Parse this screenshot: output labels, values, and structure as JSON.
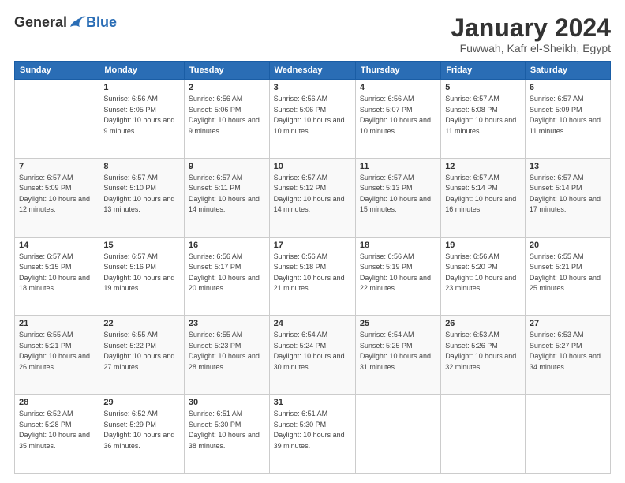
{
  "logo": {
    "general": "General",
    "blue": "Blue"
  },
  "title": "January 2024",
  "location": "Fuwwah, Kafr el-Sheikh, Egypt",
  "headers": [
    "Sunday",
    "Monday",
    "Tuesday",
    "Wednesday",
    "Thursday",
    "Friday",
    "Saturday"
  ],
  "weeks": [
    [
      {
        "day": "",
        "sunrise": "",
        "sunset": "",
        "daylight": ""
      },
      {
        "day": "1",
        "sunrise": "Sunrise: 6:56 AM",
        "sunset": "Sunset: 5:05 PM",
        "daylight": "Daylight: 10 hours and 9 minutes."
      },
      {
        "day": "2",
        "sunrise": "Sunrise: 6:56 AM",
        "sunset": "Sunset: 5:06 PM",
        "daylight": "Daylight: 10 hours and 9 minutes."
      },
      {
        "day": "3",
        "sunrise": "Sunrise: 6:56 AM",
        "sunset": "Sunset: 5:06 PM",
        "daylight": "Daylight: 10 hours and 10 minutes."
      },
      {
        "day": "4",
        "sunrise": "Sunrise: 6:56 AM",
        "sunset": "Sunset: 5:07 PM",
        "daylight": "Daylight: 10 hours and 10 minutes."
      },
      {
        "day": "5",
        "sunrise": "Sunrise: 6:57 AM",
        "sunset": "Sunset: 5:08 PM",
        "daylight": "Daylight: 10 hours and 11 minutes."
      },
      {
        "day": "6",
        "sunrise": "Sunrise: 6:57 AM",
        "sunset": "Sunset: 5:09 PM",
        "daylight": "Daylight: 10 hours and 11 minutes."
      }
    ],
    [
      {
        "day": "7",
        "sunrise": "Sunrise: 6:57 AM",
        "sunset": "Sunset: 5:09 PM",
        "daylight": "Daylight: 10 hours and 12 minutes."
      },
      {
        "day": "8",
        "sunrise": "Sunrise: 6:57 AM",
        "sunset": "Sunset: 5:10 PM",
        "daylight": "Daylight: 10 hours and 13 minutes."
      },
      {
        "day": "9",
        "sunrise": "Sunrise: 6:57 AM",
        "sunset": "Sunset: 5:11 PM",
        "daylight": "Daylight: 10 hours and 14 minutes."
      },
      {
        "day": "10",
        "sunrise": "Sunrise: 6:57 AM",
        "sunset": "Sunset: 5:12 PM",
        "daylight": "Daylight: 10 hours and 14 minutes."
      },
      {
        "day": "11",
        "sunrise": "Sunrise: 6:57 AM",
        "sunset": "Sunset: 5:13 PM",
        "daylight": "Daylight: 10 hours and 15 minutes."
      },
      {
        "day": "12",
        "sunrise": "Sunrise: 6:57 AM",
        "sunset": "Sunset: 5:14 PM",
        "daylight": "Daylight: 10 hours and 16 minutes."
      },
      {
        "day": "13",
        "sunrise": "Sunrise: 6:57 AM",
        "sunset": "Sunset: 5:14 PM",
        "daylight": "Daylight: 10 hours and 17 minutes."
      }
    ],
    [
      {
        "day": "14",
        "sunrise": "Sunrise: 6:57 AM",
        "sunset": "Sunset: 5:15 PM",
        "daylight": "Daylight: 10 hours and 18 minutes."
      },
      {
        "day": "15",
        "sunrise": "Sunrise: 6:57 AM",
        "sunset": "Sunset: 5:16 PM",
        "daylight": "Daylight: 10 hours and 19 minutes."
      },
      {
        "day": "16",
        "sunrise": "Sunrise: 6:56 AM",
        "sunset": "Sunset: 5:17 PM",
        "daylight": "Daylight: 10 hours and 20 minutes."
      },
      {
        "day": "17",
        "sunrise": "Sunrise: 6:56 AM",
        "sunset": "Sunset: 5:18 PM",
        "daylight": "Daylight: 10 hours and 21 minutes."
      },
      {
        "day": "18",
        "sunrise": "Sunrise: 6:56 AM",
        "sunset": "Sunset: 5:19 PM",
        "daylight": "Daylight: 10 hours and 22 minutes."
      },
      {
        "day": "19",
        "sunrise": "Sunrise: 6:56 AM",
        "sunset": "Sunset: 5:20 PM",
        "daylight": "Daylight: 10 hours and 23 minutes."
      },
      {
        "day": "20",
        "sunrise": "Sunrise: 6:55 AM",
        "sunset": "Sunset: 5:21 PM",
        "daylight": "Daylight: 10 hours and 25 minutes."
      }
    ],
    [
      {
        "day": "21",
        "sunrise": "Sunrise: 6:55 AM",
        "sunset": "Sunset: 5:21 PM",
        "daylight": "Daylight: 10 hours and 26 minutes."
      },
      {
        "day": "22",
        "sunrise": "Sunrise: 6:55 AM",
        "sunset": "Sunset: 5:22 PM",
        "daylight": "Daylight: 10 hours and 27 minutes."
      },
      {
        "day": "23",
        "sunrise": "Sunrise: 6:55 AM",
        "sunset": "Sunset: 5:23 PM",
        "daylight": "Daylight: 10 hours and 28 minutes."
      },
      {
        "day": "24",
        "sunrise": "Sunrise: 6:54 AM",
        "sunset": "Sunset: 5:24 PM",
        "daylight": "Daylight: 10 hours and 30 minutes."
      },
      {
        "day": "25",
        "sunrise": "Sunrise: 6:54 AM",
        "sunset": "Sunset: 5:25 PM",
        "daylight": "Daylight: 10 hours and 31 minutes."
      },
      {
        "day": "26",
        "sunrise": "Sunrise: 6:53 AM",
        "sunset": "Sunset: 5:26 PM",
        "daylight": "Daylight: 10 hours and 32 minutes."
      },
      {
        "day": "27",
        "sunrise": "Sunrise: 6:53 AM",
        "sunset": "Sunset: 5:27 PM",
        "daylight": "Daylight: 10 hours and 34 minutes."
      }
    ],
    [
      {
        "day": "28",
        "sunrise": "Sunrise: 6:52 AM",
        "sunset": "Sunset: 5:28 PM",
        "daylight": "Daylight: 10 hours and 35 minutes."
      },
      {
        "day": "29",
        "sunrise": "Sunrise: 6:52 AM",
        "sunset": "Sunset: 5:29 PM",
        "daylight": "Daylight: 10 hours and 36 minutes."
      },
      {
        "day": "30",
        "sunrise": "Sunrise: 6:51 AM",
        "sunset": "Sunset: 5:30 PM",
        "daylight": "Daylight: 10 hours and 38 minutes."
      },
      {
        "day": "31",
        "sunrise": "Sunrise: 6:51 AM",
        "sunset": "Sunset: 5:30 PM",
        "daylight": "Daylight: 10 hours and 39 minutes."
      },
      {
        "day": "",
        "sunrise": "",
        "sunset": "",
        "daylight": ""
      },
      {
        "day": "",
        "sunrise": "",
        "sunset": "",
        "daylight": ""
      },
      {
        "day": "",
        "sunrise": "",
        "sunset": "",
        "daylight": ""
      }
    ]
  ]
}
